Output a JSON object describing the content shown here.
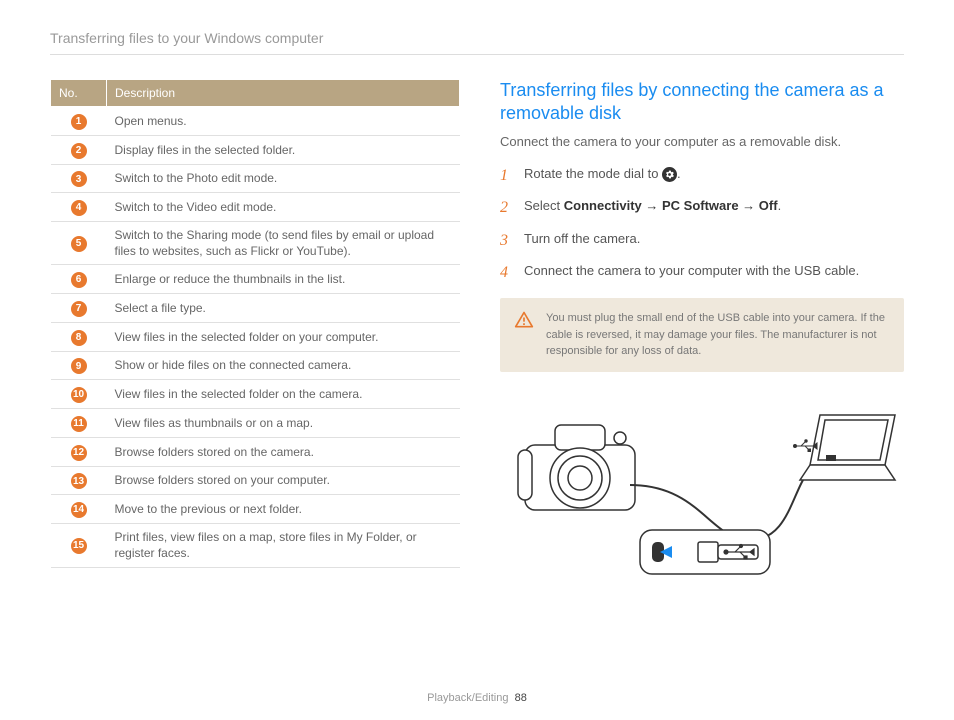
{
  "header": "Transferring files to your Windows computer",
  "table": {
    "columns": [
      "No.",
      "Description"
    ],
    "rows": [
      {
        "n": "1",
        "d": "Open menus."
      },
      {
        "n": "2",
        "d": "Display files in the selected folder."
      },
      {
        "n": "3",
        "d": "Switch to the Photo edit mode."
      },
      {
        "n": "4",
        "d": "Switch to the Video edit mode."
      },
      {
        "n": "5",
        "d": "Switch to the Sharing mode (to send files by email or upload files to websites, such as Flickr or YouTube)."
      },
      {
        "n": "6",
        "d": "Enlarge or reduce the thumbnails in the list."
      },
      {
        "n": "7",
        "d": "Select a file type."
      },
      {
        "n": "8",
        "d": "View files in the selected folder on your computer."
      },
      {
        "n": "9",
        "d": "Show or hide files on the connected camera."
      },
      {
        "n": "10",
        "d": "View files in the selected folder on the camera."
      },
      {
        "n": "11",
        "d": "View files as thumbnails or on a map."
      },
      {
        "n": "12",
        "d": "Browse folders stored on the camera."
      },
      {
        "n": "13",
        "d": "Browse folders stored on your computer."
      },
      {
        "n": "14",
        "d": "Move to the previous or next folder."
      },
      {
        "n": "15",
        "d": "Print files, view files on a map, store files in My Folder, or register faces."
      }
    ]
  },
  "section": {
    "title": "Transferring files by connecting the camera as a removable disk",
    "lead": "Connect the camera to your computer as a removable disk.",
    "steps": [
      {
        "n": "1",
        "pre": "Rotate the mode dial to ",
        "icon": "gear",
        "post": "."
      },
      {
        "n": "2",
        "pre": "Select ",
        "bold": "Connectivity → PC Software → Off",
        "post": "."
      },
      {
        "n": "3",
        "pre": "Turn off the camera."
      },
      {
        "n": "4",
        "pre": "Connect the camera to your computer with the USB cable."
      }
    ],
    "warning": "You must plug the small end of the USB cable into your camera. If the cable is reversed, it may damage your files. The manufacturer is not responsible for any loss of data."
  },
  "footer": {
    "section": "Playback/Editing",
    "page": "88"
  }
}
